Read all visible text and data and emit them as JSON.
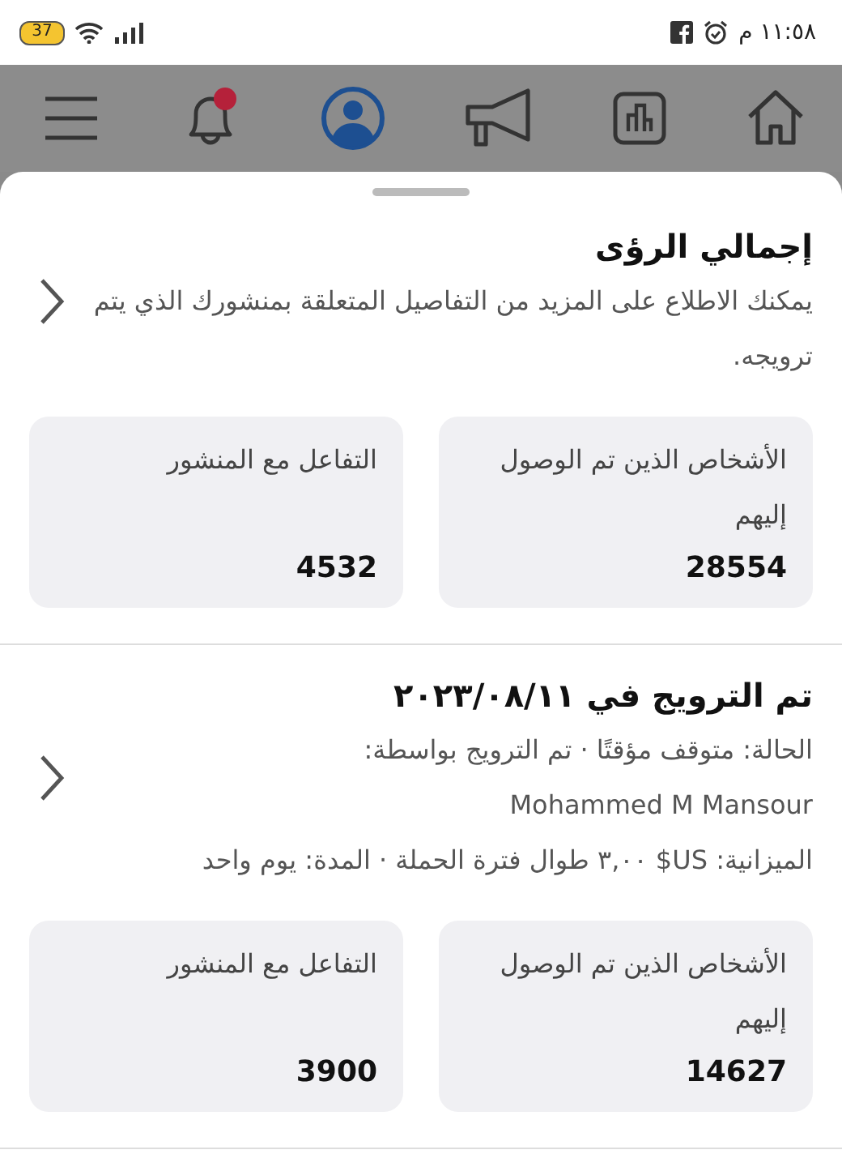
{
  "status_bar": {
    "time": "١١:٥٨ م",
    "battery": "37"
  },
  "nav_bar": {
    "items": [
      {
        "kind": "home",
        "selected": false
      },
      {
        "kind": "stats",
        "selected": false
      },
      {
        "kind": "megaphone",
        "selected": false
      },
      {
        "kind": "profile",
        "selected": true
      },
      {
        "kind": "bell",
        "selected": false
      },
      {
        "kind": "menu",
        "selected": false
      }
    ]
  },
  "summary": {
    "title": "إجمالي الرؤى",
    "description": "يمكنك الاطلاع على المزيد من التفاصيل المتعلقة بمنشورك الذي يتم ترويجه.",
    "metrics": [
      {
        "label": "الأشخاص الذين تم الوصول إليهم",
        "value": "28554"
      },
      {
        "label": "التفاعل مع المنشور",
        "value": "4532"
      }
    ]
  },
  "promotions": [
    {
      "title": "تم الترويج في ٢٠٢٣/٠٨/١١",
      "status_line": "الحالة: متوقف مؤقتًا · تم الترويج بواسطة:",
      "promoter": "Mohammed M Mansour",
      "budget_line": "الميزانية: US$ ٣,٠٠ طوال فترة الحملة · المدة: يوم واحد",
      "metrics": [
        {
          "label": "الأشخاص الذين تم الوصول إليهم",
          "value": "14627"
        },
        {
          "label": "التفاعل مع المنشور",
          "value": "3900"
        }
      ]
    }
  ]
}
